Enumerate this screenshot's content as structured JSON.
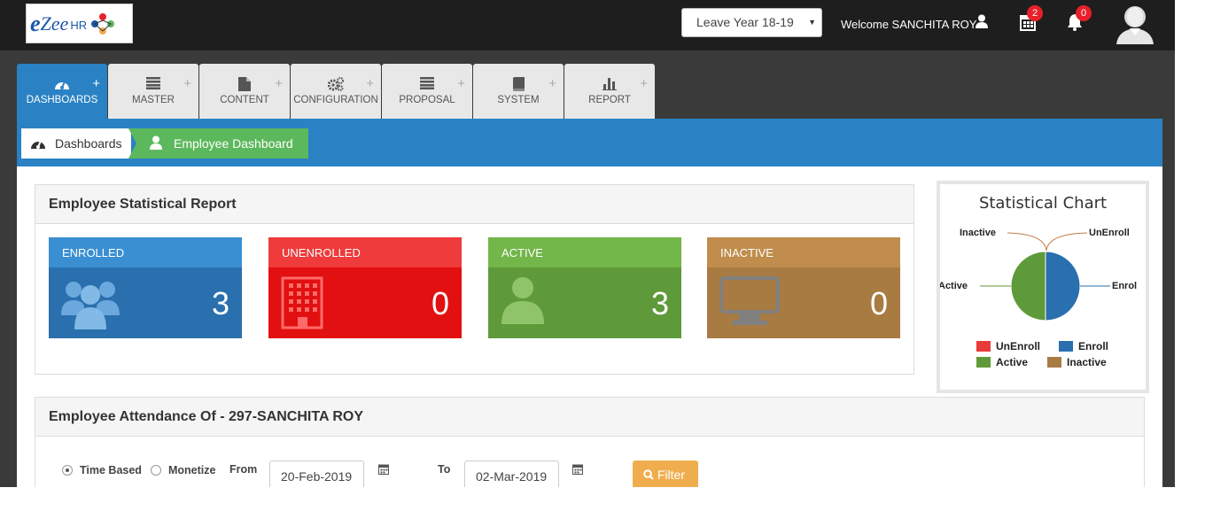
{
  "header": {
    "logo_text_e": "e",
    "logo_text_zee": "Zee",
    "logo_text_hr": "HR",
    "leave_year": "Leave Year 18-19",
    "welcome": "Welcome SANCHITA ROY",
    "calendar_badge": "2",
    "bell_badge": "0"
  },
  "nav": {
    "tabs": [
      {
        "label": "DASHBOARDS",
        "icon": "dashboard-icon",
        "active": true
      },
      {
        "label": "MASTER",
        "icon": "list-icon"
      },
      {
        "label": "CONTENT",
        "icon": "file-icon"
      },
      {
        "label": "CONFIGURATION",
        "icon": "gears-icon"
      },
      {
        "label": "PROPOSAL",
        "icon": "list-icon"
      },
      {
        "label": "SYSTEM",
        "icon": "book-icon"
      },
      {
        "label": "REPORT",
        "icon": "bar-chart-icon"
      }
    ],
    "plus": "+"
  },
  "breadcrumb": {
    "home": "Dashboards",
    "current": "Employee Dashboard"
  },
  "stats_panel": {
    "title": "Employee Statistical Report",
    "cards": [
      {
        "label": "ENROLLED",
        "value": "3",
        "color_head": "#3a8fd2",
        "color_body": "#2a6fae"
      },
      {
        "label": "UNENROLLED",
        "value": "0",
        "color_head": "#ef3b3b",
        "color_body": "#e21010"
      },
      {
        "label": "ACTIVE",
        "value": "3",
        "color_head": "#73b64a",
        "color_body": "#5f9a3a"
      },
      {
        "label": "INACTIVE",
        "value": "0",
        "color_head": "#c08d4d",
        "color_body": "#a87b42"
      }
    ]
  },
  "chart_data": {
    "type": "pie",
    "title": "Statistical Chart",
    "slice_labels": [
      "Inactive",
      "UnEnroll",
      "Active",
      "Enrol"
    ],
    "legend": [
      {
        "name": "UnEnroll",
        "color": "#e83a3a"
      },
      {
        "name": "Enroll",
        "color": "#2a6fae"
      },
      {
        "name": "Active",
        "color": "#5f9a3a"
      },
      {
        "name": "Inactive",
        "color": "#a87b42"
      }
    ],
    "values": {
      "UnEnroll": 0,
      "Enroll": 3,
      "Active": 3,
      "Inactive": 0
    }
  },
  "attendance": {
    "title": "Employee Attendance Of - 297-SANCHITA ROY",
    "time_based": "Time Based",
    "monetize": "Monetize",
    "from_label": "From",
    "from_value": "20-Feb-2019",
    "to_label": "To",
    "to_value": "02-Mar-2019",
    "filter": "Filter"
  }
}
